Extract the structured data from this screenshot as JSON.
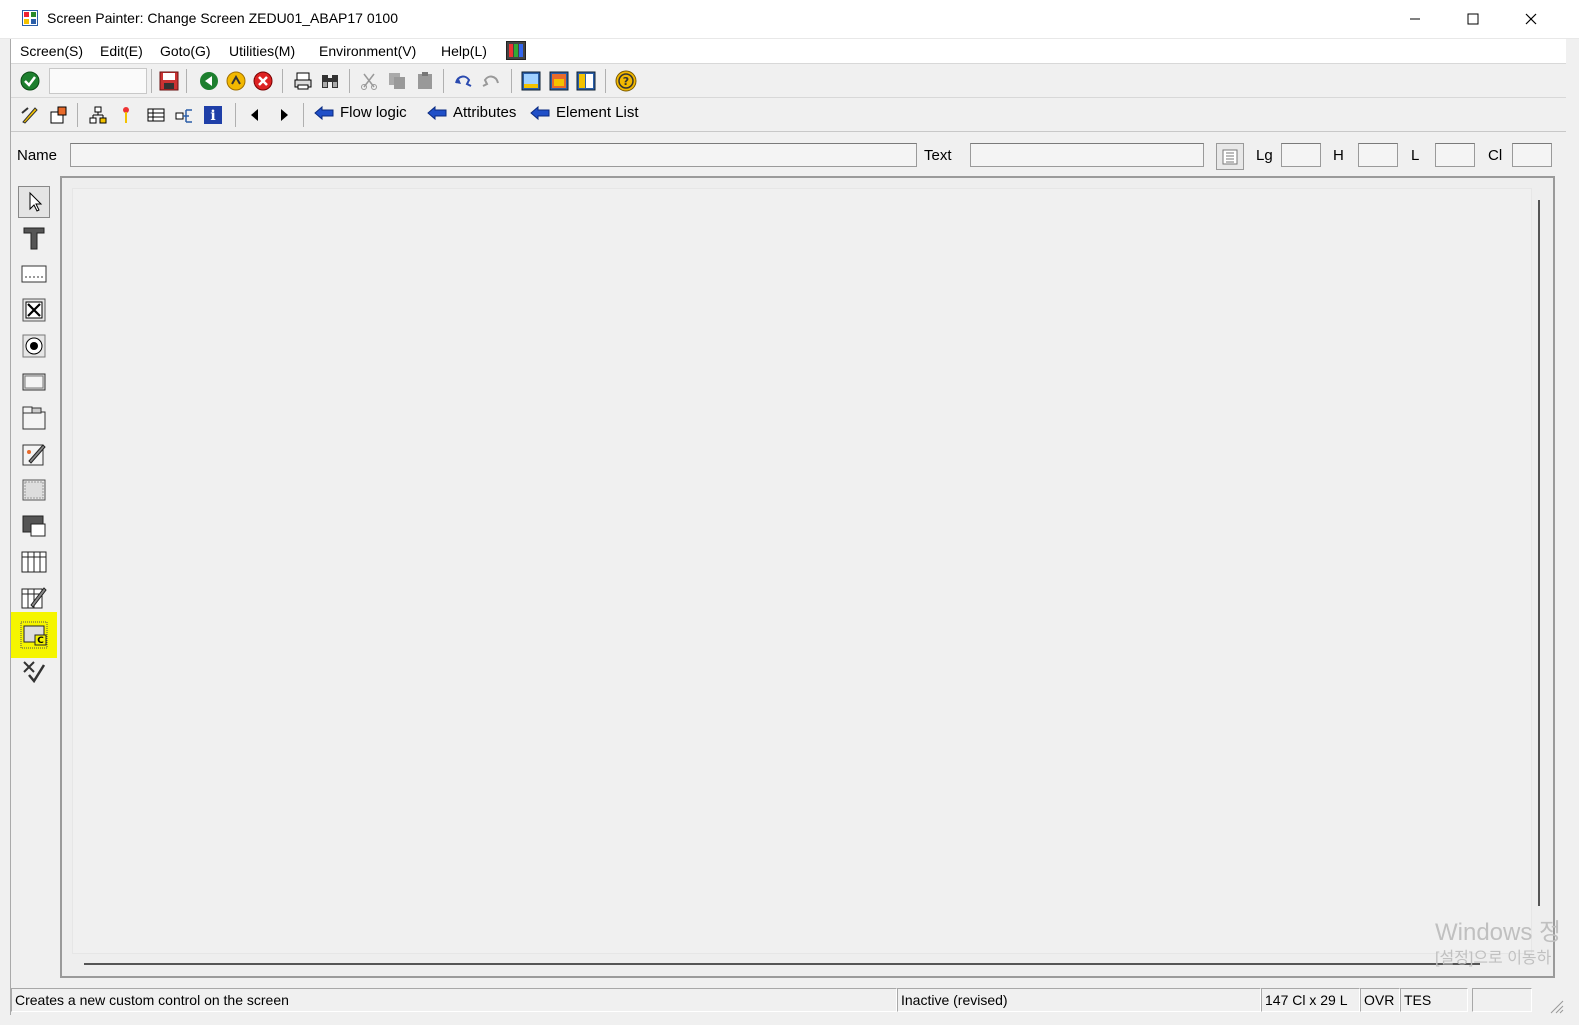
{
  "window": {
    "title": "Screen Painter:  Change Screen ZEDU01_ABAP17 0100",
    "controls": [
      "minimize-icon",
      "maximize-icon",
      "close-icon"
    ]
  },
  "menubar": {
    "items": [
      "Screen(S)",
      "Edit(E)",
      "Goto(G)",
      "Utilities(M)",
      "Environment(V)",
      "Help(L)"
    ]
  },
  "toolbar1": {
    "icons": [
      "check-icon",
      "save-icon",
      "back-icon",
      "exit-icon",
      "cancel-icon",
      "print-icon",
      "find-icon",
      "find-next-icon",
      "cut-icon",
      "copy-icon",
      "paste-icon",
      "undo-icon",
      "redo-icon",
      "layout-icon-1",
      "layout-icon-2",
      "layout-icon-3",
      "help-icon"
    ]
  },
  "toolbar2": {
    "icons": [
      "edit-icon",
      "object-icon",
      "hierarchy-icon",
      "pointer-icon",
      "dict-icon",
      "transfer-icon",
      "info-icon",
      "prev-icon",
      "next-icon"
    ],
    "links": {
      "flow_logic": "Flow logic",
      "attributes": "Attributes",
      "element_list": "Element List"
    }
  },
  "attributes_bar": {
    "name_label": "Name",
    "name_value": "",
    "text_label": "Text",
    "text_value": "",
    "lg_label": "Lg",
    "h_label": "H",
    "l_label": "L",
    "cl_label": "Cl"
  },
  "palette": {
    "tools": [
      "select-pointer-icon",
      "text-field-icon",
      "input-field-icon",
      "checkbox-icon",
      "radio-button-icon",
      "pushbutton-icon",
      "tabstrip-icon",
      "tabstrip-wizard-icon",
      "box-icon",
      "subscreen-icon",
      "table-control-icon",
      "table-control-wizard-icon",
      "custom-control-icon",
      "status-icon-tool"
    ],
    "highlighted": "custom-control-icon"
  },
  "watermark": {
    "line1": "Windows 정",
    "line2": "[설정]으로 이동하"
  },
  "statusbar": {
    "message": "Creates a new custom control on the screen",
    "state": "Inactive (revised)",
    "size": "147 Cl x 29 L",
    "mode": "OVR",
    "system": "TES"
  }
}
